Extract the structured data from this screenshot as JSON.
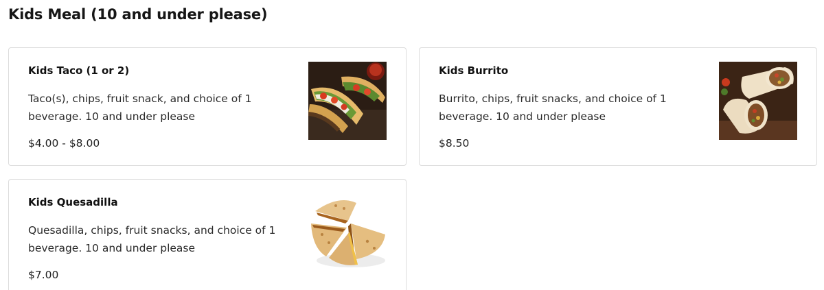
{
  "section": {
    "title": "Kids Meal (10 and under please)"
  },
  "items": [
    {
      "name": "Kids Taco (1 or 2)",
      "description": "Taco(s), chips, fruit snack, and choice of 1 beverage. 10 and under please",
      "price": "$4.00 - $8.00",
      "image": "taco-photo"
    },
    {
      "name": "Kids Burrito",
      "description": "Burrito, chips, fruit snacks, and choice of 1 beverage. 10 and under please",
      "price": "$8.50",
      "image": "burrito-photo"
    },
    {
      "name": "Kids Quesadilla",
      "description": "Quesadilla, chips, fruit snacks, and choice of 1 beverage. 10 and under please",
      "price": "$7.00",
      "image": "quesadilla-photo"
    }
  ]
}
